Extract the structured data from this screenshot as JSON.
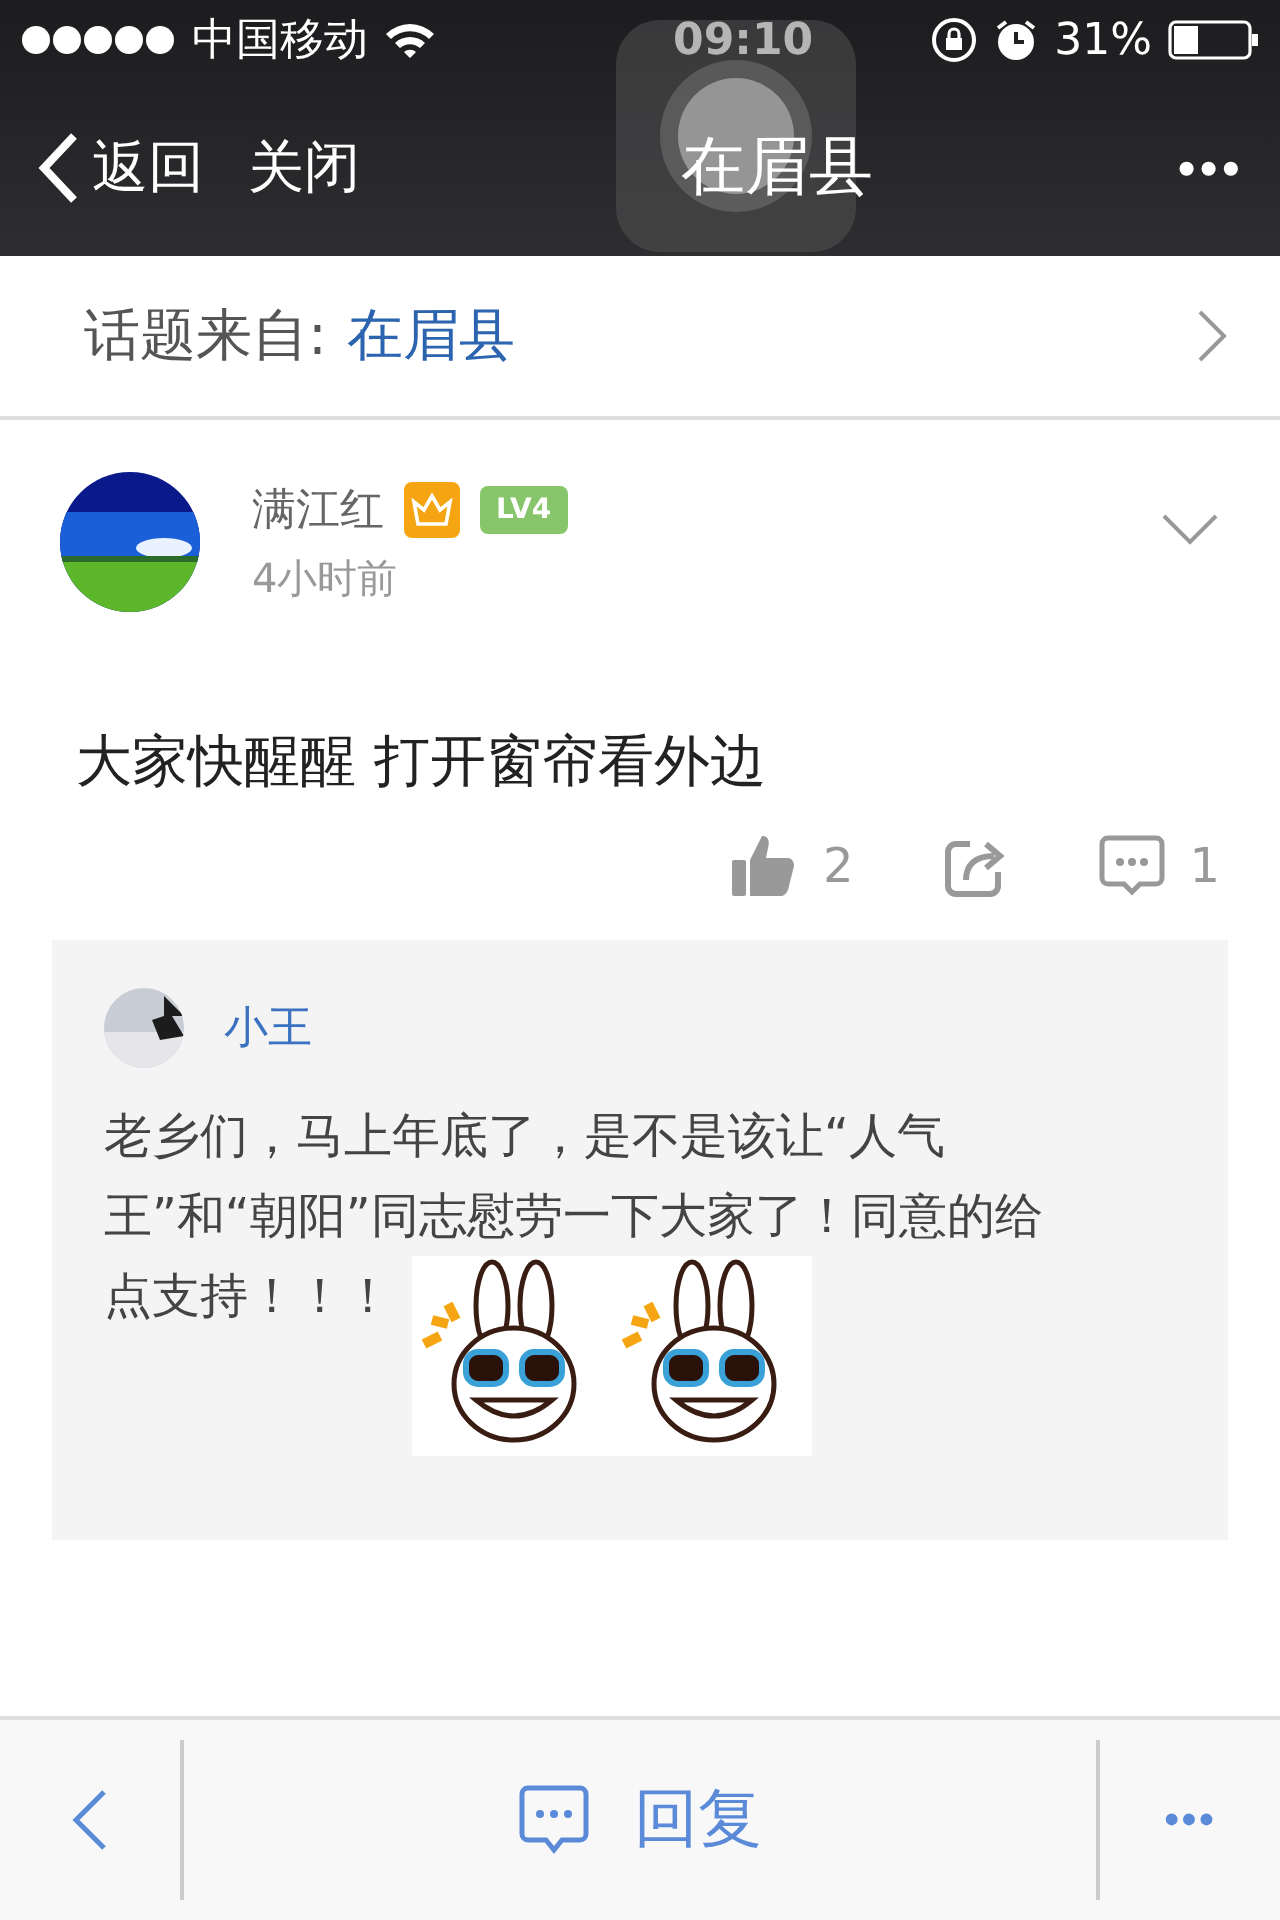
{
  "status_bar": {
    "carrier": "中国移动",
    "time": "09:10",
    "battery": "31%"
  },
  "nav": {
    "back": "返回",
    "close": "关闭",
    "title": "在眉县",
    "more": "•••"
  },
  "topic": {
    "label": "话题来自:",
    "name": "在眉县"
  },
  "post": {
    "author": "满江红",
    "vip": true,
    "level_badge": "LV4",
    "time": "4小时前",
    "text": "大家快醒醒 打开窗帘看外边",
    "likes": "2",
    "comments": "1",
    "reply": {
      "author": "小王",
      "text": "老乡们，马上年底了，是不是该让“人气王”和“朝阳”同志慰劳一下大家了！同意的给点支持！！！",
      "stickers": [
        {
          "kind": "sticker"
        },
        {
          "kind": "sticker"
        }
      ]
    }
  },
  "bottom_bar": {
    "reply": "回复",
    "more": "•••"
  }
}
